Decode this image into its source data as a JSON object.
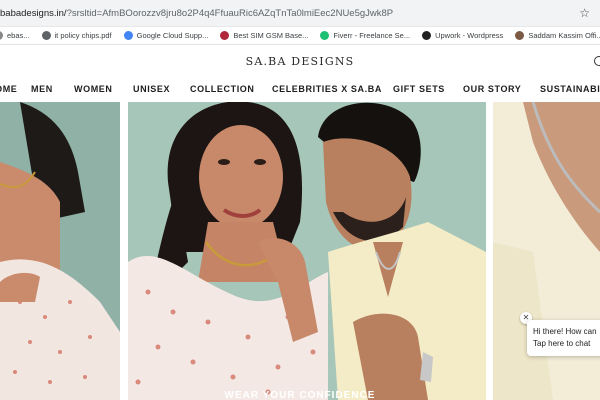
{
  "browser": {
    "url_host": "babadesigns.in/",
    "url_query": "?srsltid=AfmBOorozzv8jru8o2P4q4FfuauRic6AZqTnTa0lmiEec2NUe5gJwk8P",
    "star_icon": "star-icon",
    "bookmarks": [
      {
        "label": "ebas...",
        "icon": "folder-icon",
        "color": "#888888"
      },
      {
        "label": "it policy chips.pdf",
        "icon": "globe-icon",
        "color": "#5f6368"
      },
      {
        "label": "Google Cloud Supp...",
        "icon": "google-icon",
        "color": "#4285f4"
      },
      {
        "label": "Best SIM GSM Base...",
        "icon": "site-icon",
        "color": "#b0263b"
      },
      {
        "label": "Fiverr - Freelance Se...",
        "icon": "fiverr-icon",
        "color": "#1dbf73"
      },
      {
        "label": "Upwork - Wordpress",
        "icon": "upwork-icon",
        "color": "#222222"
      },
      {
        "label": "Saddam Kassim Offi...",
        "icon": "avatar-icon",
        "color": "#7a5a44"
      }
    ]
  },
  "site": {
    "logo": "SA.BA DESIGNS",
    "nav": [
      "HOME",
      "MEN",
      "WOMEN",
      "UNISEX",
      "COLLECTION",
      "CELEBRITIES X SA.BA",
      "GIFT SETS",
      "OUR STORY",
      "SUSTAINABILITY"
    ]
  },
  "hero": {
    "banner_text": "WEAR YOUR CONFIDENCE"
  },
  "chat": {
    "line1": "Hi there! How can",
    "line2": "Tap here to chat"
  },
  "colors": {
    "accent_teal": "#9fc2b5",
    "cream": "#f3edd8"
  }
}
